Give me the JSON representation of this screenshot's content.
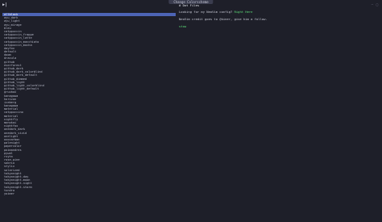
{
  "window": {
    "title": "Change Colorscheme",
    "controls": [
      "—",
      "□"
    ]
  },
  "prompt_icon": "▶|",
  "sidebar": {
    "items": [
      {
        "label": "allblack",
        "selected": true
      },
      {
        "label": "ayu_dark"
      },
      {
        "label": "ayu_light"
      },
      {
        "label": "ayu_mirage"
      },
      {
        "label": "bleu"
      },
      {
        "label": "catppuccin"
      },
      {
        "label": "catppuccin_frappe"
      },
      {
        "label": "catppuccin_latte"
      },
      {
        "label": "catppuccin_macchiato"
      },
      {
        "label": "catppuccin_mocha"
      },
      {
        "label": "dayfox"
      },
      {
        "label": "default"
      },
      {
        "label": "doom"
      },
      {
        "label": "dracula"
      },
      {
        "label": "github"
      },
      {
        "label": "everforest"
      },
      {
        "label": "github_dark"
      },
      {
        "label": "github_dark_colorblind"
      },
      {
        "label": "github_dark_default"
      },
      {
        "label": "github_dimmed"
      },
      {
        "label": "github_light"
      },
      {
        "label": "github_light_colorblind"
      },
      {
        "label": "github_light_default"
      },
      {
        "label": "gruvbox"
      },
      {
        "label": "kanagawa"
      },
      {
        "label": "horizon"
      },
      {
        "label": "iceberg"
      },
      {
        "label": "kanagawa"
      },
      {
        "label": "material"
      },
      {
        "label": "catppuccino"
      },
      {
        "label": "material"
      },
      {
        "label": "nightfly"
      },
      {
        "label": "monokai"
      },
      {
        "label": "nightfox"
      },
      {
        "label": "onedark_dark"
      },
      {
        "label": "onedark_vivid"
      },
      {
        "label": "onelight"
      },
      {
        "label": "oxocarbon"
      },
      {
        "label": "palenight"
      },
      {
        "label": "papercolor"
      },
      {
        "label": "poimandres"
      },
      {
        "label": "pywal"
      },
      {
        "label": "rxyhn"
      },
      {
        "label": "rose-pine"
      },
      {
        "label": "sobrio"
      },
      {
        "label": "stylix"
      },
      {
        "label": "solarized"
      },
      {
        "label": "tokyonight"
      },
      {
        "label": "tokyonight-day"
      },
      {
        "label": "tokyonight-moon"
      },
      {
        "label": "tokyonight-night"
      },
      {
        "label": "tokyonight-storm"
      },
      {
        "label": "tundra"
      },
      {
        "label": "yoimer"
      }
    ]
  },
  "preview": {
    "heading": "# Dot Files",
    "line1_prefix": "Looking for my NeoVim config?",
    "line1_link": "Right Here",
    "line2": "NeoVim credit goes to @kiner, give him a follow.",
    "code": "stow"
  },
  "colors": {
    "background": "#1e1f29",
    "selection": "#4d64b5",
    "link": "#5fe07a",
    "text": "#c8cad6"
  }
}
